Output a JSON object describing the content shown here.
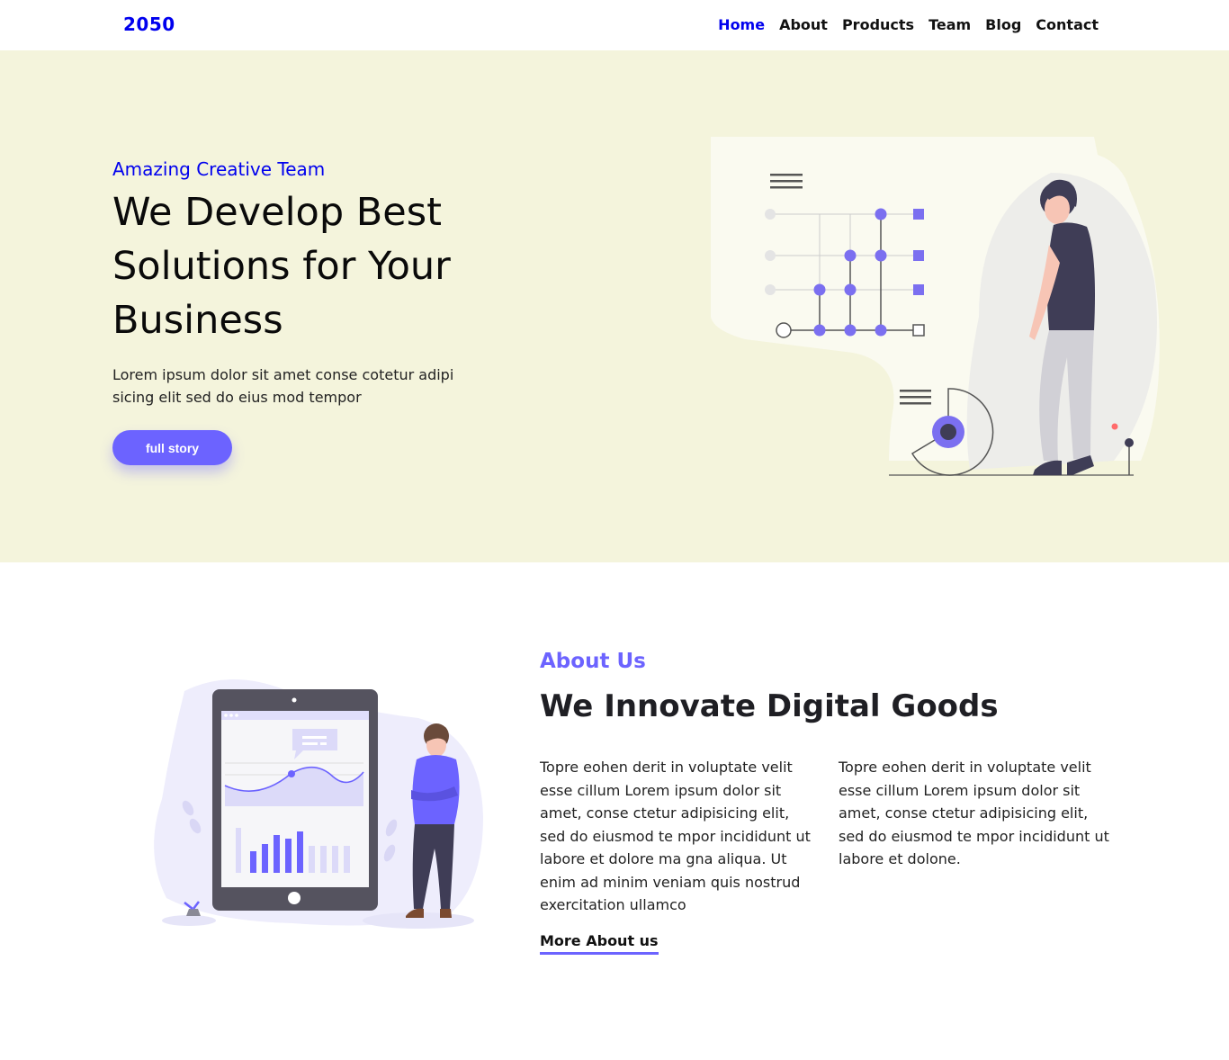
{
  "nav": {
    "logo": "2050",
    "items": [
      {
        "label": "Home",
        "active": true
      },
      {
        "label": "About",
        "active": false
      },
      {
        "label": "Products",
        "active": false
      },
      {
        "label": "Team",
        "active": false
      },
      {
        "label": "Blog",
        "active": false
      },
      {
        "label": "Contact",
        "active": false
      }
    ]
  },
  "hero": {
    "kicker": "Amazing Creative Team",
    "title": "We Develop Best Solutions for Your Business",
    "text": "Lorem ipsum dolor sit amet conse cotetur adipi sicing elit sed do eius mod tempor",
    "button_label": "full story"
  },
  "about": {
    "kicker": "About Us",
    "title": "We Innovate Digital Goods",
    "col1": "Topre eohen derit in voluptate velit esse cillum Lorem ipsum dolor sit amet, conse ctetur adipisicing elit, sed do eiusmod te mpor incididunt ut labore et dolore ma gna aliqua. Ut enim ad minim veniam quis nostrud exercitation ullamco",
    "col2": "Topre eohen derit in voluptate velit esse cillum Lorem ipsum dolor sit amet, conse ctetur adipisicing elit, sed do eiusmod te mpor incididunt ut labore et dolone.",
    "link_label": "More About us"
  },
  "colors": {
    "accent": "#6c63ff",
    "link_blue": "#0000ee",
    "hero_bg": "#f4f4dc"
  }
}
